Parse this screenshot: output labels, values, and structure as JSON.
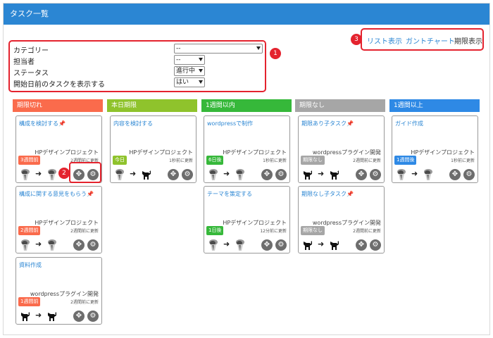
{
  "header": {
    "title": "タスク一覧"
  },
  "filters": {
    "rows": [
      {
        "label": "カテゴリー",
        "value": "--"
      },
      {
        "label": "担当者",
        "value": "--"
      },
      {
        "label": "ステータス",
        "value": "進行中"
      },
      {
        "label": "開始日前のタスクを表示する",
        "value": "はい"
      }
    ]
  },
  "callouts": {
    "one": "1",
    "two": "2",
    "three": "3"
  },
  "views": {
    "list": "リスト表示",
    "gantt": "ガントチャート",
    "deadline": "期限表示"
  },
  "colors": {
    "header": "#2b86d3",
    "overdue": "#fa6b4c",
    "today": "#8fc32c",
    "within_week": "#36b83a",
    "no_deadline": "#a6a6a6",
    "over_week": "#2e89e5",
    "callout": "#e4232e"
  },
  "columns": [
    {
      "title": "期限切れ",
      "cards": [
        {
          "title": "構成を検討する",
          "pinned": true,
          "project": "HPデザインプロジェクト",
          "updated": "2週間前に更新",
          "deadline": "3週間前",
          "from": "avatar-person-icon",
          "to": "avatar-person-icon"
        },
        {
          "title": "構成に関する意見をもらう",
          "pinned": true,
          "project": "HPデザインプロジェクト",
          "updated": "2週間前に更新",
          "deadline": "2週間前",
          "from": "avatar-person-icon",
          "to": "avatar-person-icon"
        },
        {
          "title": "資料作成",
          "pinned": false,
          "project": "wordpressプラグイン開発",
          "updated": "2週間前に更新",
          "deadline": "1週間前",
          "from": "avatar-dog-icon",
          "to": "avatar-dog-icon"
        }
      ]
    },
    {
      "title": "本日期限",
      "cards": [
        {
          "title": "内容を検討する",
          "pinned": false,
          "project": "HPデザインプロジェクト",
          "updated": "1秒前に更新",
          "deadline": "今日",
          "from": "avatar-person-icon",
          "to": "avatar-dog-icon"
        }
      ]
    },
    {
      "title": "1週間以内",
      "cards": [
        {
          "title": "wordpressで制作",
          "pinned": false,
          "project": "HPデザインプロジェクト",
          "updated": "1秒前に更新",
          "deadline": "6日後",
          "from": "avatar-person-icon",
          "to": "avatar-person-icon"
        },
        {
          "title": "テーマを策定する",
          "pinned": false,
          "project": "HPデザインプロジェクト",
          "updated": "12分前に更新",
          "deadline": "1日後",
          "from": "avatar-person-icon",
          "to": "avatar-person-icon"
        }
      ]
    },
    {
      "title": "期限なし",
      "cards": [
        {
          "title": "期限あり子タスク",
          "pinned": true,
          "project": "wordpressプラグイン開発",
          "updated": "2週間前に更新",
          "deadline": "期限なし",
          "from": "avatar-dog-icon",
          "to": "avatar-dog-icon"
        },
        {
          "title": "期限なし子タスク",
          "pinned": true,
          "project": "wordpressプラグイン開発",
          "updated": "2週間前に更新",
          "deadline": "期限なし",
          "from": "avatar-dog-icon",
          "to": "avatar-dog-icon"
        }
      ]
    },
    {
      "title": "1週間以上",
      "cards": [
        {
          "title": "ガイド作成",
          "pinned": false,
          "project": "HPデザインプロジェクト",
          "updated": "1秒前に更新",
          "deadline": "1週間後",
          "from": "avatar-person-icon",
          "to": "avatar-person-icon"
        }
      ]
    }
  ]
}
